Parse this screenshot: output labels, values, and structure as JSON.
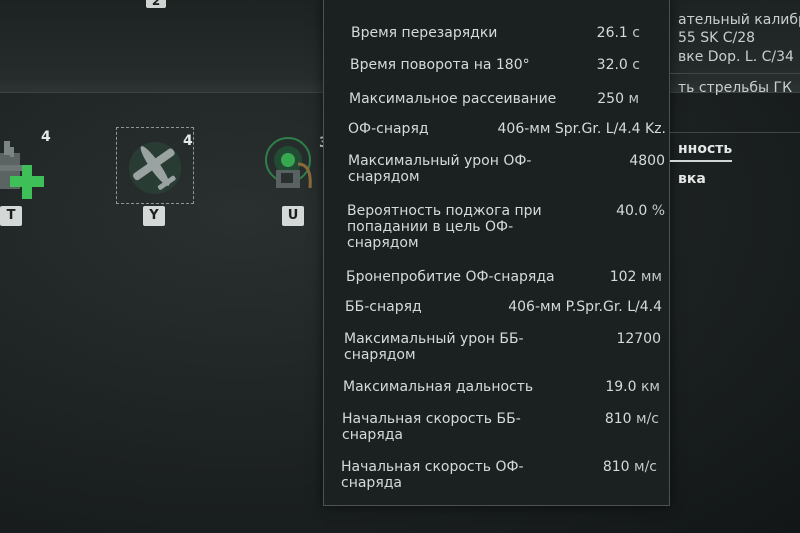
{
  "top_badge": "2",
  "consumables": [
    {
      "count": "4",
      "key": "T"
    },
    {
      "count": "4",
      "key": "Y"
    },
    {
      "count": "3",
      "key": "U"
    }
  ],
  "tooltip": {
    "rows": [
      {
        "label": "Время перезарядки",
        "value": "26.1",
        "unit": "с"
      },
      {
        "label": "Время поворота на 180°",
        "value": "32.0",
        "unit": "с"
      },
      {
        "label": "Максимальное рассеивание",
        "value": "250",
        "unit": "м"
      },
      {
        "label": "ОФ-снаряд",
        "value": "406-мм Spr.Gr. L/4.4 Kz.",
        "unit": ""
      },
      {
        "label": "Максимальный урон ОФ-снарядом",
        "value": "4800",
        "unit": ""
      },
      {
        "label": "Вероятность поджога при попадании в цель ОФ-снарядом",
        "value": "40.0",
        "unit": "%"
      },
      {
        "label": "Бронепробитие ОФ-снаряда",
        "value": "102",
        "unit": "мм"
      },
      {
        "label": "ББ-снаряд",
        "value": "406-мм P.Spr.Gr. L/4.4",
        "unit": ""
      },
      {
        "label": "Максимальный урон ББ-снарядом",
        "value": "12700",
        "unit": ""
      },
      {
        "label": "Максимальная дальность",
        "value": "19.0",
        "unit": "км"
      },
      {
        "label": "Начальная скорость ББ-снаряда",
        "value": "810",
        "unit": "м/с"
      },
      {
        "label": "Начальная скорость ОФ-снаряда",
        "value": "810",
        "unit": "м/с"
      }
    ]
  },
  "right_panel": {
    "line1": "ательный калибр",
    "line2": "55 SK C/28",
    "line3": "вке Dop. L. C/34",
    "line4": "ть стрельбы ГК",
    "tab1": "нность",
    "tab2": "вка"
  },
  "colors": {
    "accent_green": "#3fbf57",
    "panel_bg": "#1b2020"
  }
}
